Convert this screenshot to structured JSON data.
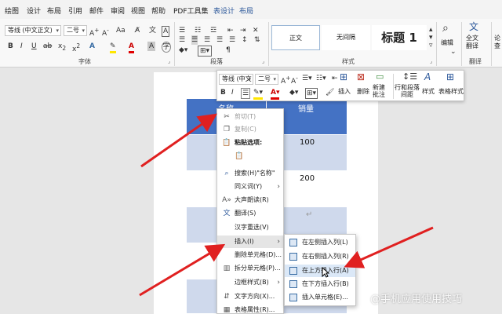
{
  "tabs": [
    "绘图",
    "设计",
    "布局",
    "引用",
    "邮件",
    "审阅",
    "视图",
    "帮助",
    "PDF工具集",
    "表设计",
    "布局"
  ],
  "ribbon": {
    "font_name": "等线 (中文正文)",
    "font_size": "二号",
    "groups": {
      "font": "字体",
      "paragraph": "段落",
      "styles": "样式"
    },
    "styles": [
      "正文",
      "无间隔",
      "标题 1"
    ],
    "editing": "编辑",
    "translate": "全文\n翻译",
    "translate_group": "翻译",
    "partial_right": "论\n查"
  },
  "table": {
    "header": {
      "col1": "名称",
      "col2": "销量"
    },
    "rows": [
      {
        "col2": "100"
      },
      {
        "col2": "200"
      },
      {
        "col2": ""
      },
      {
        "col2": ""
      },
      {
        "col2": ""
      }
    ]
  },
  "minibar": {
    "font_name": "等线 (中文",
    "font_size": "二号",
    "insert": "插入",
    "delete": "删除",
    "new_comment": "新建\n批注",
    "spacing": "行和段落\n间距",
    "style": "样式",
    "table_style": "表格样式"
  },
  "context_menu": [
    {
      "label": "剪切(T)",
      "icon": "scissors-icon",
      "disabled": true
    },
    {
      "label": "复制(C)",
      "icon": "copy-icon",
      "disabled": true
    },
    {
      "label": "粘贴选项:",
      "icon": "paste-icon",
      "bold": true
    },
    {
      "label": "",
      "icon": "paste-text-icon"
    },
    {
      "label": "搜索(H)\"名称\"",
      "icon": "search-icon"
    },
    {
      "label": "同义词(Y)",
      "icon": "",
      "submenu": true
    },
    {
      "label": "大声朗读(R)",
      "icon": "read-aloud-icon"
    },
    {
      "label": "翻译(S)",
      "icon": "translate-icon"
    },
    {
      "label": "汉字重选(V)",
      "icon": ""
    },
    {
      "label": "插入(I)",
      "icon": "",
      "submenu": true,
      "hot": true
    },
    {
      "label": "删除单元格(D)...",
      "icon": ""
    },
    {
      "label": "拆分单元格(P)...",
      "icon": "split-cells-icon"
    },
    {
      "label": "边框样式(B)",
      "icon": "",
      "submenu": true
    },
    {
      "label": "文字方向(X)...",
      "icon": "text-direction-icon"
    },
    {
      "label": "表格属性(R)...",
      "icon": "table-properties-icon"
    }
  ],
  "submenu": [
    {
      "label": "在左侧插入列(L)"
    },
    {
      "label": "在右侧插入列(R)"
    },
    {
      "label": "在上方插入行(A)",
      "hot": true
    },
    {
      "label": "在下方插入行(B)"
    },
    {
      "label": "插入单元格(E)..."
    }
  ],
  "watermark": "@手机应用使用技巧",
  "colors": {
    "accent": "#2b579a",
    "table_header": "#4472c4",
    "table_band": "#cfd9ec",
    "arrow": "#e02020"
  }
}
